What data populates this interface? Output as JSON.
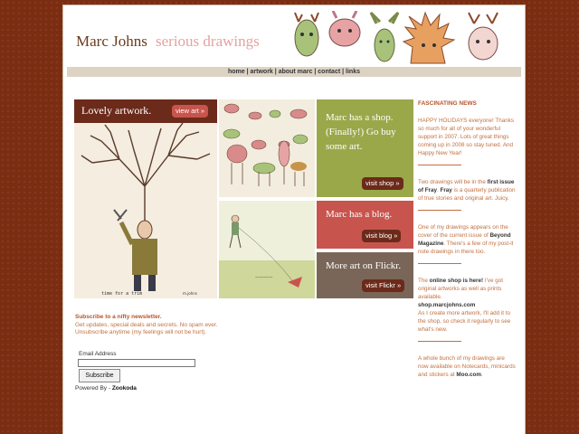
{
  "header": {
    "name": "Marc Johns",
    "tagline": "serious drawings"
  },
  "nav": [
    "home",
    "artwork",
    "about marc",
    "contact",
    "links"
  ],
  "tiles": {
    "lovely": {
      "title": "Lovely artwork.",
      "button": "view art »",
      "caption": "time for a trim",
      "signature": "m.johns"
    },
    "shop": {
      "text": "Marc has a shop. (Finally!) Go buy some art.",
      "button": "visit shop »"
    },
    "blog": {
      "text": "Marc has a blog.",
      "button": "visit blog »"
    },
    "flickr": {
      "text": "More art on Flickr.",
      "button": "visit Flickr »"
    }
  },
  "newsletter": {
    "heading": "Subscribe to a nifty newsletter.",
    "description": "Get updates, special deals and secrets. No spam ever. Unsubscribe anytime (my feelings will not be hurt).",
    "email_label": "Email Address",
    "email_value": "",
    "subscribe": "Subscribe",
    "powered_prefix": "Powered By - ",
    "powered_name": "Zookoda"
  },
  "news": {
    "title": "FASCINATING NEWS",
    "item1": "HAPPY HOLIDAYS everyone! Thanks so much for all of your wonderful support in 2007. Lots of great things coming up in 2008 so stay tuned. And Happy New Year!",
    "item2_a": "Two drawings will be in the ",
    "item2_b": "first issue of Fray",
    "item2_c": ". ",
    "item2_d": "Fray",
    "item2_e": " is a quarterly publication of true stories and original art. Juicy.",
    "item3_a": "One of my drawings appears on the cover of the current issue of ",
    "item3_b": "Beyond Magazine",
    "item3_c": ". There's a few of my post-it note drawings in there too.",
    "item4_a": "The ",
    "item4_b": "online shop is here!",
    "item4_c": " I've got original artworks as well as prints available.",
    "item4_d": "shop.marcjohns.com",
    "item4_e": "As I create more artwork, I'll add it to the shop, so check it regularly to see what's new.",
    "item5_a": "A whole bunch of my drawings are now available on Notecards, minicards and stickers at ",
    "item5_b": "Moo.com",
    "item5_c": "."
  }
}
